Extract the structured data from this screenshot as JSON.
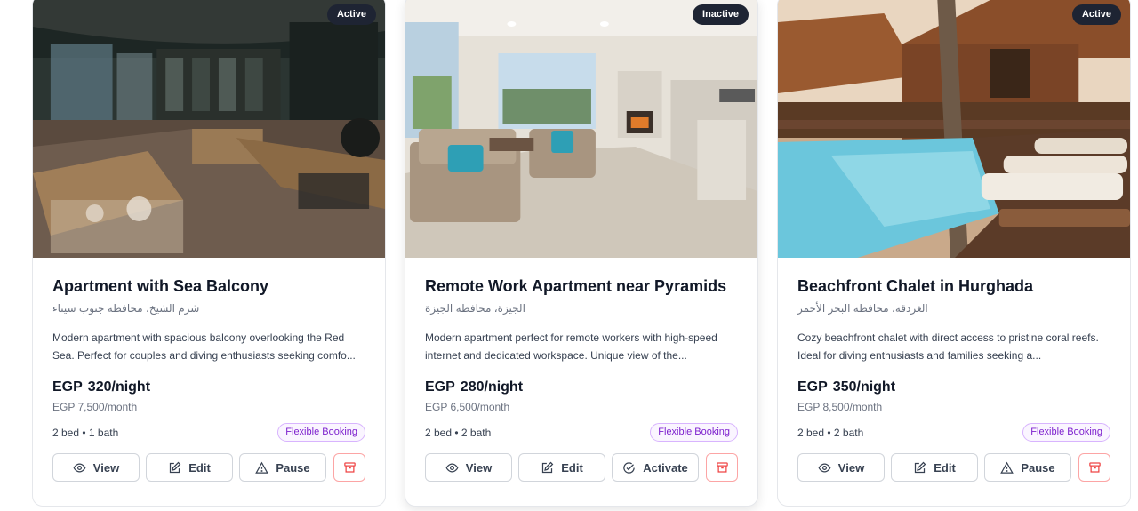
{
  "listings": [
    {
      "status": "Active",
      "title": "Apartment with Sea Balcony",
      "location": "شرم الشيخ، محافظة جنوب سيناء",
      "description": "Modern apartment with spacious balcony overlooking the Red Sea. Perfect for couples and diving enthusiasts seeking comfo...",
      "currency": "EGP",
      "price_night": "320/night",
      "price_month": "EGP  7,500/month",
      "rooms": "2 bed • 1 bath",
      "tag": "Flexible Booking",
      "actions": {
        "view": "View",
        "edit": "Edit",
        "toggle": "Pause"
      },
      "toggle_icon": "alert-triangle-icon",
      "image": "cafe-interior"
    },
    {
      "status": "Inactive",
      "title": "Remote Work Apartment near Pyramids",
      "location": "الجيزة، محافظة الجيزة",
      "description": "Modern apartment perfect for remote workers with high-speed internet and dedicated workspace. Unique view of the...",
      "currency": "EGP",
      "price_night": "280/night",
      "price_month": "EGP  6,500/month",
      "rooms": "2 bed • 2 bath",
      "tag": "Flexible Booking",
      "actions": {
        "view": "View",
        "edit": "Edit",
        "toggle": "Activate"
      },
      "toggle_icon": "check-circle-icon",
      "image": "living-room"
    },
    {
      "status": "Active",
      "title": "Beachfront Chalet in Hurghada",
      "location": "الغردقة، محافظة البحر الأحمر",
      "description": "Cozy beachfront chalet with direct access to pristine coral reefs. Ideal for diving enthusiasts and families seeking a...",
      "currency": "EGP",
      "price_night": "350/night",
      "price_month": "EGP  8,500/month",
      "rooms": "2 bed • 2 bath",
      "tag": "Flexible Booking",
      "actions": {
        "view": "View",
        "edit": "Edit",
        "toggle": "Pause"
      },
      "toggle_icon": "alert-triangle-icon",
      "image": "beach-resort-pool"
    }
  ],
  "colors": {
    "badge_bg": "#1e2433",
    "tag_text": "#7e22ce",
    "tag_border": "#d8b4fe",
    "delete": "#ef4444"
  }
}
